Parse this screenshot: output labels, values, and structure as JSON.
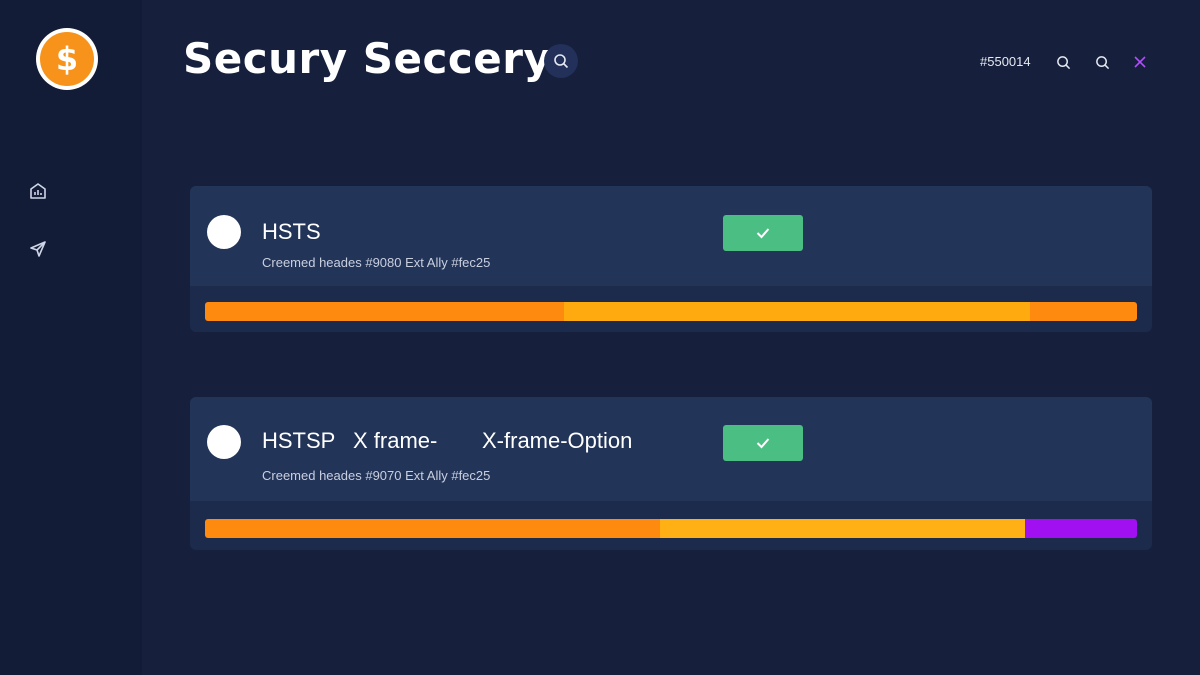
{
  "app": {
    "title": "Secury Seccery",
    "logo_symbol": "$",
    "accent": "#f7931a"
  },
  "topbar": {
    "code": "#550014",
    "icons": [
      "search-icon",
      "search-icon",
      "close-icon"
    ]
  },
  "sidebar": {
    "items": [
      {
        "icon": "dashboard-icon"
      },
      {
        "icon": "send-icon"
      }
    ]
  },
  "cards": [
    {
      "title": "HSTS",
      "subtitle": "Creemed heades #9080 Ext Ally #fec25",
      "status": "check",
      "progress_segments": [
        {
          "color": "#ff8a10",
          "fraction": 0.385
        },
        {
          "color": "#ffab0f",
          "fraction": 0.5
        },
        {
          "color": "#ff8a10",
          "fraction": 0.115
        }
      ]
    },
    {
      "title": "HSTSP",
      "title_part2": "X frame-",
      "title_part3": "X-frame-Option",
      "subtitle": "Creemed heades #9070 Ext Ally #fec25",
      "status": "check",
      "progress_segments": [
        {
          "color": "#ff8a10",
          "fraction": 0.488
        },
        {
          "color": "#ffb014",
          "fraction": 0.392
        },
        {
          "color": "#a010f0",
          "fraction": 0.12
        }
      ]
    }
  ],
  "colors": {
    "background": "#16203c",
    "sidebar": "#131c36",
    "card": "#1c2a4c",
    "success": "#4bbf83",
    "close_accent": "#b44cff"
  }
}
